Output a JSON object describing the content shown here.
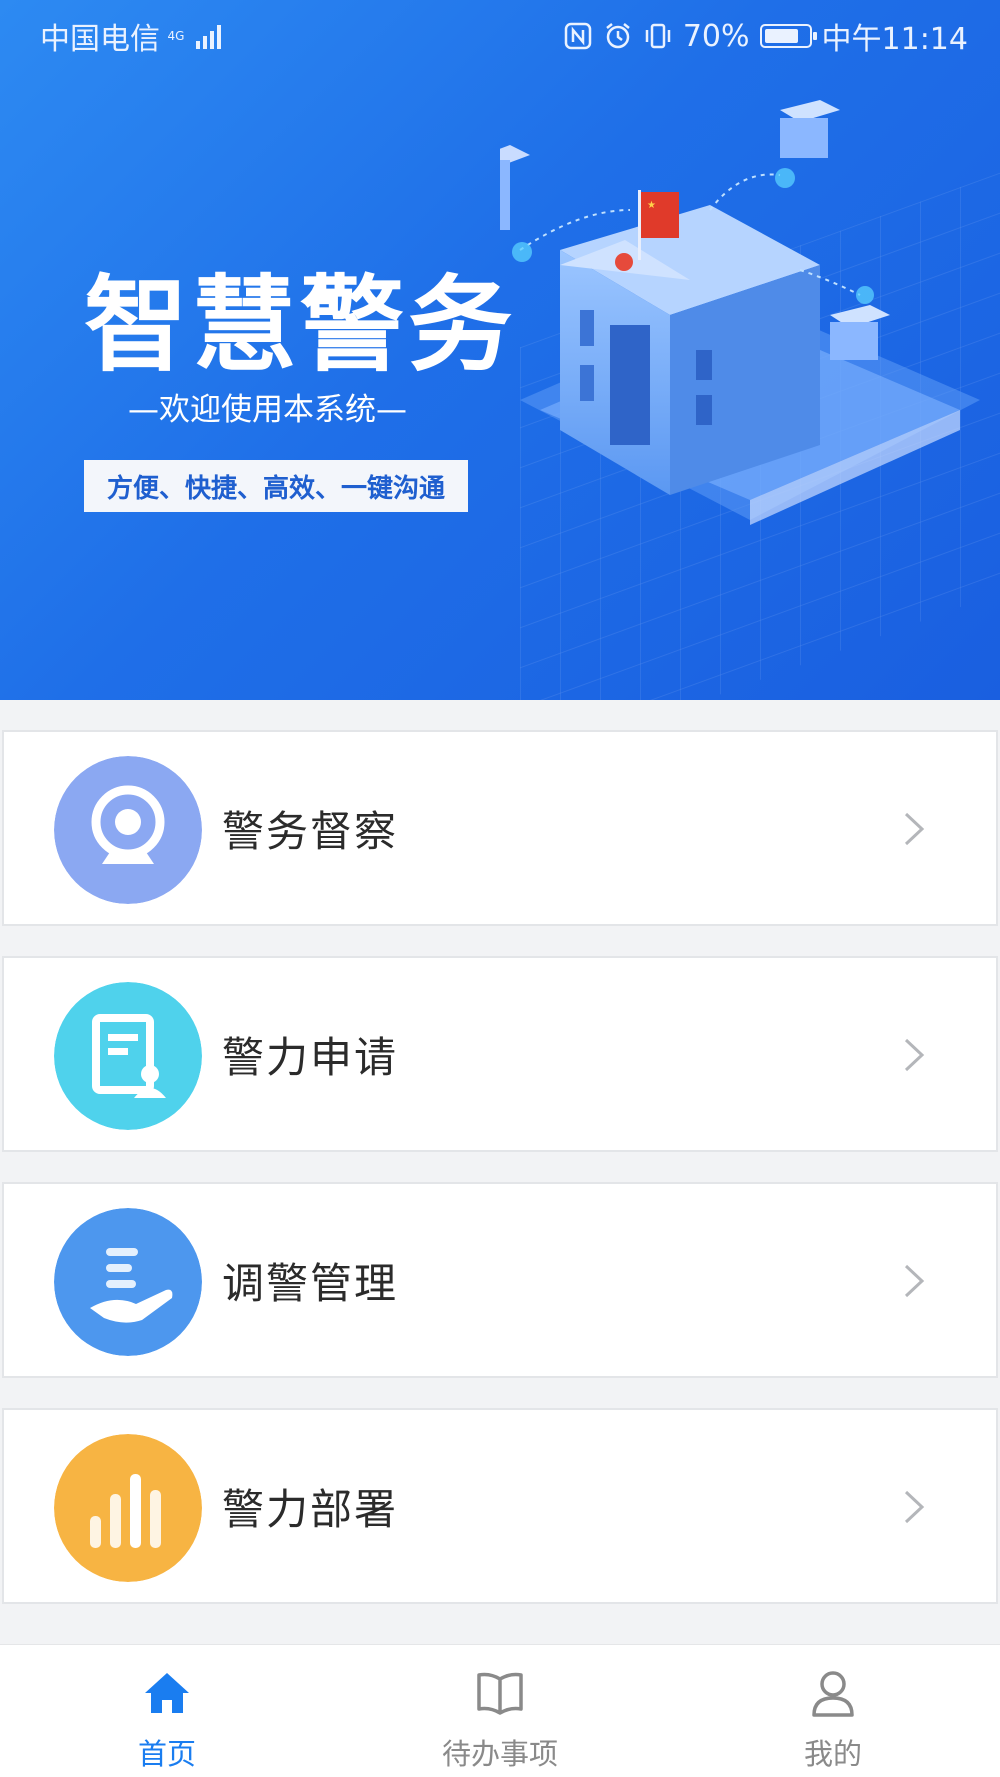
{
  "status_bar": {
    "carrier": "中国电信",
    "network": "4G",
    "battery": "70%",
    "time": "中午11:14"
  },
  "banner": {
    "title": "智慧警务",
    "subtitle": "—欢迎使用本系统—",
    "tagline": "方便、快捷、高效、一键沟通"
  },
  "menu": {
    "items": [
      {
        "label": "警务督察",
        "icon": "webcam-icon",
        "color": "#8ba8f2"
      },
      {
        "label": "警力申请",
        "icon": "document-user-icon",
        "color": "#4fd2ec"
      },
      {
        "label": "调警管理",
        "icon": "hand-dispatch-icon",
        "color": "#4d97ee"
      },
      {
        "label": "警力部署",
        "icon": "bar-chart-icon",
        "color": "#f7b443"
      }
    ]
  },
  "tabs": [
    {
      "label": "首页",
      "icon": "home-icon",
      "active": true
    },
    {
      "label": "待办事项",
      "icon": "book-icon",
      "active": false
    },
    {
      "label": "我的",
      "icon": "user-icon",
      "active": false
    }
  ],
  "colors": {
    "accent": "#1a7df0",
    "tab_inactive": "#8a8a8a"
  }
}
